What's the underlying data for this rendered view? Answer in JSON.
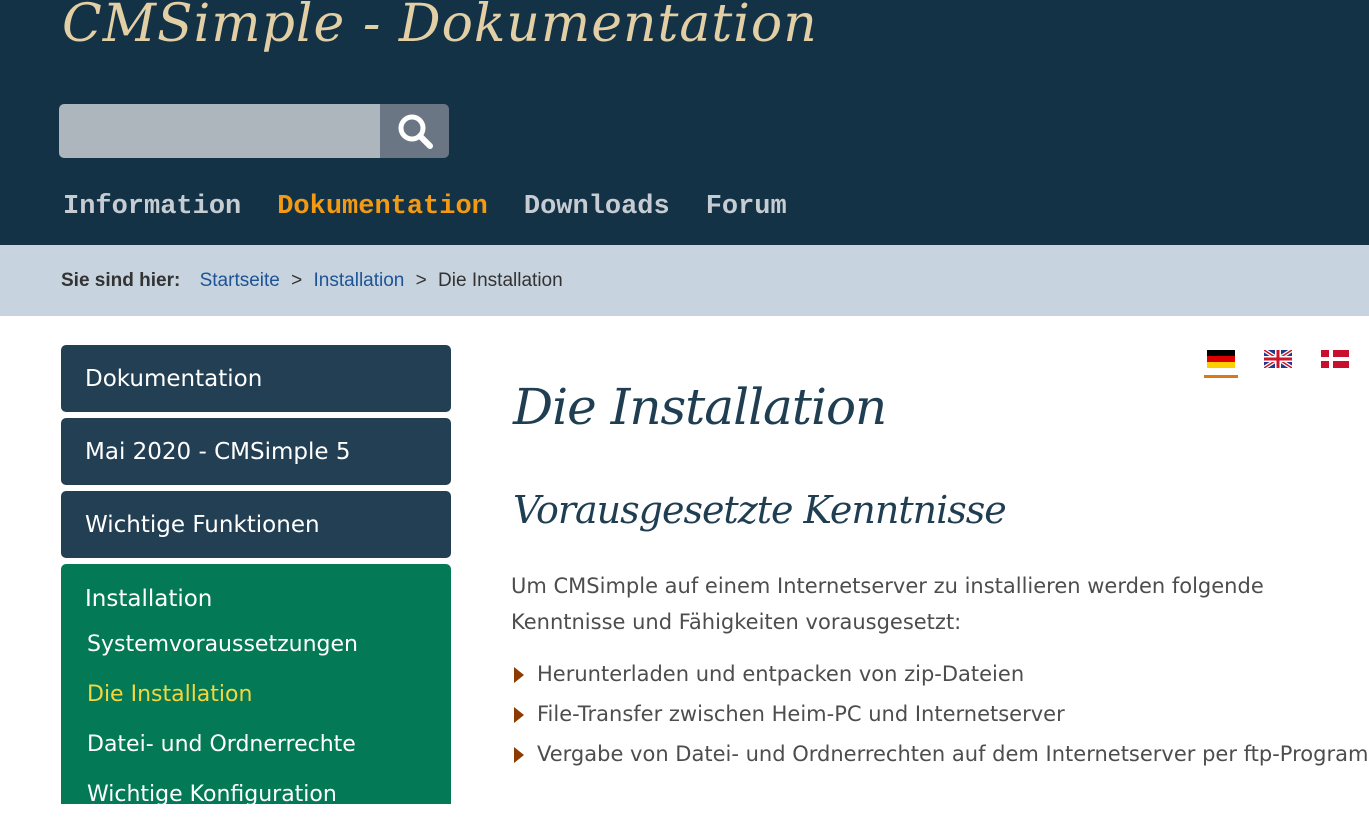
{
  "header": {
    "site_title": "CMSimple - Dokumentation",
    "search": {
      "placeholder": "",
      "value": "",
      "button_icon": "search-icon"
    },
    "nav": [
      {
        "label": "Information",
        "active": false
      },
      {
        "label": "Dokumentation",
        "active": true
      },
      {
        "label": "Downloads",
        "active": false
      },
      {
        "label": "Forum",
        "active": false
      }
    ]
  },
  "breadcrumb": {
    "label": "Sie sind hier:",
    "items": [
      {
        "text": "Startseite",
        "link": true
      },
      {
        "text": "Installation",
        "link": true
      },
      {
        "text": "Die Installation",
        "link": false
      }
    ],
    "separator": ">"
  },
  "sidebar": {
    "items": [
      {
        "label": "Dokumentation"
      },
      {
        "label": "Mai 2020 - CMSimple 5"
      },
      {
        "label": "Wichtige Funktionen"
      }
    ],
    "active": {
      "label": "Installation",
      "children": [
        {
          "label": "Systemvoraussetzungen",
          "current": false
        },
        {
          "label": "Die Installation",
          "current": true
        },
        {
          "label": "Datei- und Ordnerrechte",
          "current": false
        },
        {
          "label": "Wichtige Konfiguration",
          "current": false
        }
      ]
    }
  },
  "languages": [
    {
      "name": "german-flag-icon",
      "selected": true
    },
    {
      "name": "uk-flag-icon",
      "selected": false
    },
    {
      "name": "danish-flag-icon",
      "selected": false
    }
  ],
  "main": {
    "title": "Die Installation",
    "section_title": "Vorausgesetzte Kenntnisse",
    "intro": "Um CMSimple auf einem Internetserver zu installieren werden folgende Kenntnisse und Fähigkeiten vorausgesetzt:",
    "bullets": [
      "Herunterladen und entpacken von zip-Dateien",
      "File-Transfer zwischen Heim-PC und Internetserver",
      "Vergabe von Datei- und Ordnerrechten auf dem Internetserver per ftp-Programm"
    ]
  },
  "colors": {
    "header_bg": "#133245",
    "title_color": "#e3cfa5",
    "nav_active": "#f39a12",
    "breadcrumb_bg": "#c7d3de",
    "sidebar_btn": "#233f53",
    "sidebar_active": "#037a55",
    "current_subitem": "#f5d63f",
    "bullet_arrow": "#8c3a00"
  }
}
